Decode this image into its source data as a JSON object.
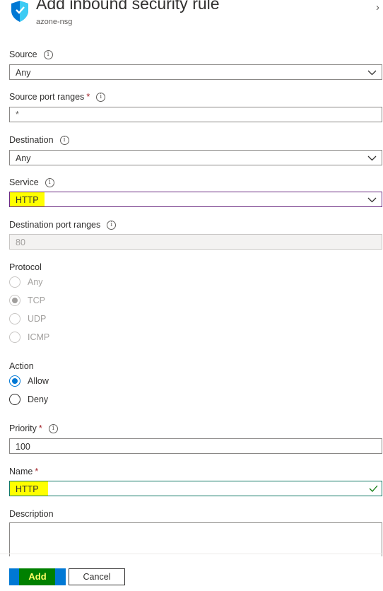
{
  "header": {
    "title": "Add inbound security rule",
    "subtitle": "azone-nsg"
  },
  "form": {
    "source": {
      "label": "Source",
      "value": "Any"
    },
    "source_port_ranges": {
      "label": "Source port ranges",
      "required": "*",
      "value": "*"
    },
    "destination": {
      "label": "Destination",
      "value": "Any"
    },
    "service": {
      "label": "Service",
      "value": "HTTP"
    },
    "destination_port_ranges": {
      "label": "Destination port ranges",
      "value": "80"
    },
    "protocol": {
      "label": "Protocol",
      "options": [
        "Any",
        "TCP",
        "UDP",
        "ICMP"
      ],
      "selected": "TCP"
    },
    "action": {
      "label": "Action",
      "options": [
        "Allow",
        "Deny"
      ],
      "selected": "Allow"
    },
    "priority": {
      "label": "Priority",
      "required": "*",
      "value": "100"
    },
    "name": {
      "label": "Name",
      "required": "*",
      "value": "HTTP"
    },
    "description": {
      "label": "Description",
      "value": ""
    }
  },
  "buttons": {
    "add": "Add",
    "cancel": "Cancel"
  },
  "icons": {
    "info": "i",
    "shield": "shield-icon",
    "chevron_right": "›"
  },
  "colors": {
    "accent": "#0078d4",
    "highlight": "#ffff00",
    "valid": "#107c10",
    "required": "#a4262c"
  }
}
